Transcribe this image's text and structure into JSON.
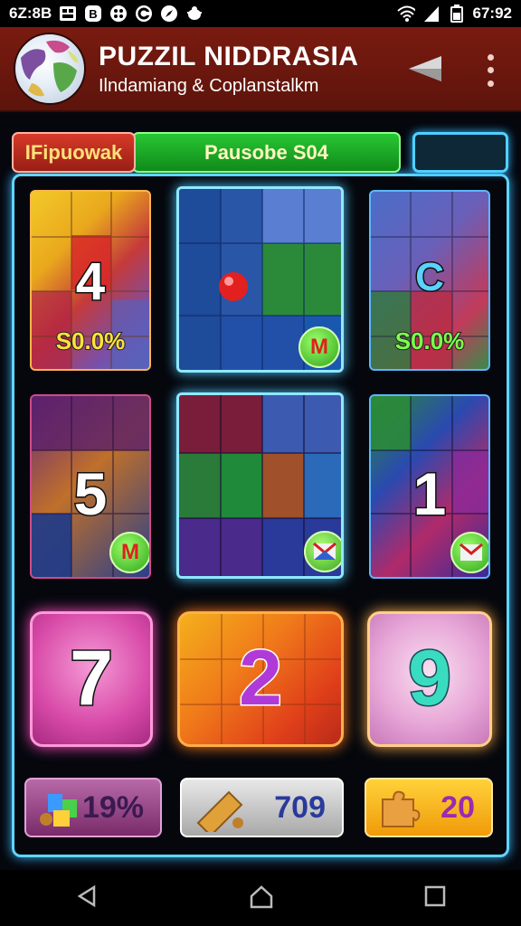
{
  "status_bar": {
    "time_left": "6Z:8B",
    "time_right": "67:92"
  },
  "app": {
    "title": "PUZZIL NIDDRASIA",
    "subtitle": "Ilndamiang & Coplanstalkm"
  },
  "tabs": {
    "red_label": "IFipuowak",
    "green_label": "Pausobe S04"
  },
  "cards": [
    {
      "number": "4",
      "percent": "S0.0%"
    },
    {
      "number": "",
      "percent": "",
      "badge": "M"
    },
    {
      "number": "C",
      "percent": "S0.0%"
    },
    {
      "number": "5",
      "percent": "",
      "badge": "M"
    },
    {
      "number": "",
      "percent": "",
      "badge": "envelope"
    },
    {
      "number": "1",
      "percent": "",
      "badge": "envelope"
    },
    {
      "number": "7"
    },
    {
      "number": "2"
    },
    {
      "number": "9"
    }
  ],
  "bottom_buttons": [
    {
      "label": "19%",
      "icon": "blocks-icon"
    },
    {
      "label": "709",
      "icon": "ticket-icon"
    },
    {
      "label": "20",
      "icon": "puzzle-piece-icon"
    }
  ],
  "colors": {
    "appbar": "#6d1810",
    "border_glow": "#5fd6ff",
    "tab_green": "#1fa82a",
    "tab_red": "#c22c1f"
  }
}
